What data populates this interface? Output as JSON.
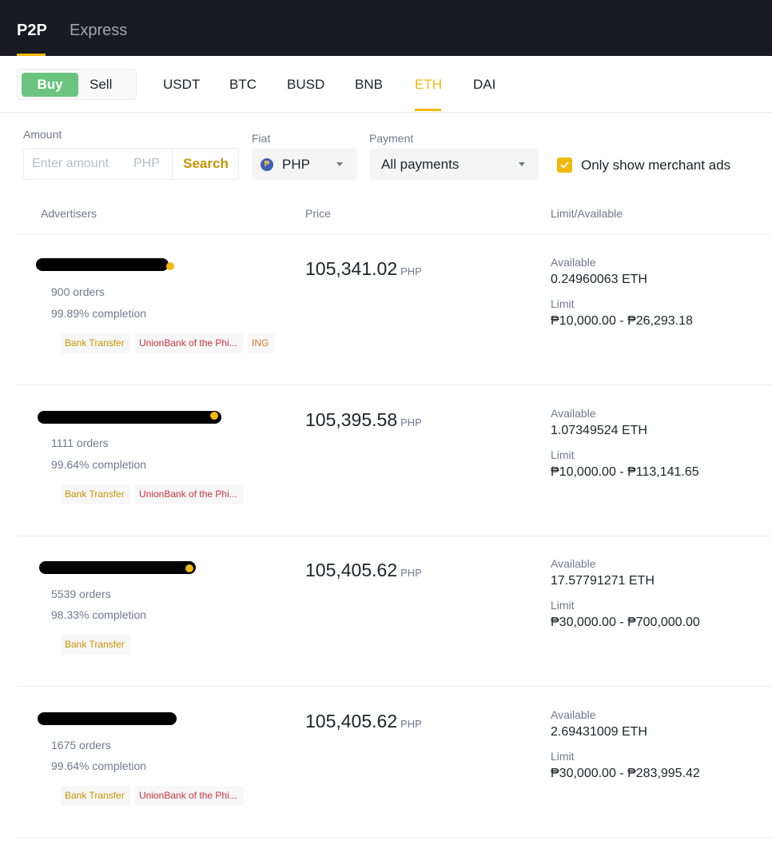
{
  "nav": {
    "tabs": [
      "P2P",
      "Express"
    ]
  },
  "trade": {
    "buy_label": "Buy",
    "sell_label": "Sell",
    "assets": [
      "USDT",
      "BTC",
      "BUSD",
      "BNB",
      "ETH",
      "DAI"
    ],
    "selected_asset": "ETH"
  },
  "filters": {
    "amount_label": "Amount",
    "amount_placeholder": "Enter amount",
    "amount_unit": "PHP",
    "search_label": "Search",
    "fiat_label": "Fiat",
    "fiat_value": "PHP",
    "payment_label": "Payment",
    "payment_value": "All payments",
    "merchant_only_label": "Only show merchant ads",
    "merchant_only_checked": true
  },
  "table": {
    "headers": [
      "Advertisers",
      "Price",
      "Limit/Available"
    ],
    "available_label": "Available",
    "limit_label": "Limit",
    "rows": [
      {
        "orders": "900 orders",
        "completion": "99.89% completion",
        "price": "105,341.02",
        "currency": "PHP",
        "available": "0.24960063 ETH",
        "limit": "₱10,000.00 - ₱26,293.18",
        "payments": [
          "Bank Transfer",
          "UnionBank of the Phi...",
          "ING"
        ]
      },
      {
        "orders": "1111 orders",
        "completion": "99.64% completion",
        "price": "105,395.58",
        "currency": "PHP",
        "available": "1.07349524 ETH",
        "limit": "₱10,000.00 - ₱113,141.65",
        "payments": [
          "Bank Transfer",
          "UnionBank of the Phi..."
        ]
      },
      {
        "orders": "5539 orders",
        "completion": "98.33% completion",
        "price": "105,405.62",
        "currency": "PHP",
        "available": "17.57791271 ETH",
        "limit": "₱30,000.00 - ₱700,000.00",
        "payments": [
          "Bank Transfer"
        ]
      },
      {
        "orders": "1675 orders",
        "completion": "99.64% completion",
        "price": "105,405.62",
        "currency": "PHP",
        "available": "2.69431009 ETH",
        "limit": "₱30,000.00 - ₱283,995.42",
        "payments": [
          "Bank Transfer",
          "UnionBank of the Phi..."
        ]
      }
    ]
  },
  "colors": {
    "accent": "#f0b90b",
    "buy": "#6bc47e",
    "nav_bg": "#181a20"
  }
}
